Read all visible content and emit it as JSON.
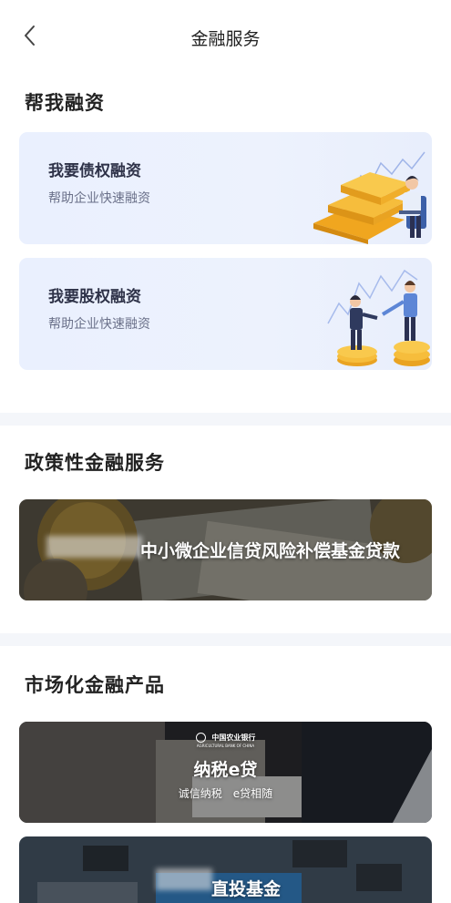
{
  "header": {
    "title": "金融服务"
  },
  "financing": {
    "title": "帮我融资",
    "cards": [
      {
        "title": "我要债权融资",
        "subtitle": "帮助企业快速融资"
      },
      {
        "title": "我要股权融资",
        "subtitle": "帮助企业快速融资"
      }
    ]
  },
  "policy": {
    "title": "政策性金融服务",
    "banner_text": "中小微企业信贷风险补偿基金贷款"
  },
  "market": {
    "title": "市场化金融产品",
    "products": [
      {
        "bank_name": "中国农业银行",
        "bank_name_en": "AGRICULTURAL BANK OF CHINA",
        "title": "纳税e贷",
        "slogan": "诚信纳税　e贷相随"
      },
      {
        "title": "直投基金"
      }
    ]
  },
  "colors": {
    "card_bg": "#ecf1fd",
    "gold": "#f5b531",
    "divider": "#f4f6fa"
  },
  "icons": {
    "back": "chevron-left-icon"
  }
}
